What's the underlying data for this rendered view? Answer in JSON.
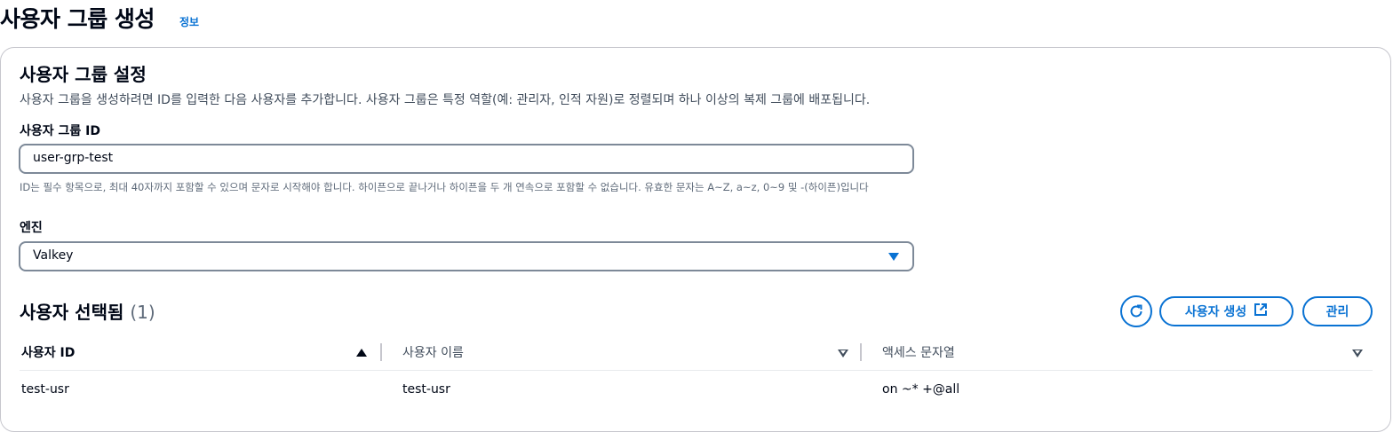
{
  "header": {
    "title": "사용자 그룹 생성",
    "info_link": "정보"
  },
  "settings": {
    "title": "사용자 그룹 설정",
    "description": "사용자 그룹을 생성하려면 ID를 입력한 다음 사용자를 추가합니다. 사용자 그룹은 특정 역할(예: 관리자, 인적 자원)로 정렬되며 하나 이상의 복제 그룹에 배포됩니다.",
    "id_field": {
      "label": "사용자 그룹 ID",
      "value": "user-grp-test",
      "hint": "ID는 필수 항목으로, 최대 40자까지 포함할 수 있으며 문자로 시작해야 합니다. 하이픈으로 끝나거나 하이픈을 두 개 연속으로 포함할 수 없습니다. 유효한 문자는 A~Z, a~z, 0~9 및 -(하이픈)입니다"
    },
    "engine_field": {
      "label": "엔진",
      "value": "Valkey"
    }
  },
  "users": {
    "title": "사용자 선택됨",
    "count": "(1)",
    "buttons": {
      "refresh_icon": "refresh-icon",
      "create_label": "사용자 생성",
      "create_icon": "external-link-icon",
      "manage_label": "관리"
    },
    "columns": [
      "사용자 ID",
      "사용자 이름",
      "액세스 문자열"
    ],
    "rows": [
      [
        "test-usr",
        "test-usr",
        "on ~* +@all"
      ]
    ]
  },
  "colors": {
    "accent": "#0972d3",
    "text": "#000716",
    "border": "#7d8998"
  }
}
